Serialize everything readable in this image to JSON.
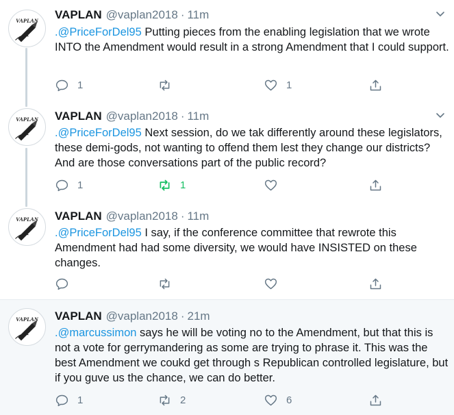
{
  "tweets": [
    {
      "name": "VAPLAN",
      "handle": "@vaplan2018",
      "sep": "·",
      "time": "11m",
      "mention": ".@PriceForDel95",
      "body": " Putting pieces from the enabling legislation that we wrote INTO the Amendment would result in a strong Amendment that I could support.",
      "reply_count": "1",
      "retweet_count": "",
      "like_count": "1",
      "retweeted": false
    },
    {
      "name": "VAPLAN",
      "handle": "@vaplan2018",
      "sep": "·",
      "time": "11m",
      "mention": ".@PriceForDel95",
      "body": " Next session, do we tak differently around these legislators, these demi-gods, not wanting to offend them lest they change our districts? And are those conversations part of the public record?",
      "reply_count": "1",
      "retweet_count": "1",
      "like_count": "",
      "retweeted": true
    },
    {
      "name": "VAPLAN",
      "handle": "@vaplan2018",
      "sep": "·",
      "time": "11m",
      "mention": ".@PriceForDel95",
      "body": " I say, if the conference committee that rewrote this Amendment had had some diversity, we would have INSISTED on these changes.",
      "reply_count": "",
      "retweet_count": "",
      "like_count": "",
      "retweeted": false
    },
    {
      "name": "VAPLAN",
      "handle": "@vaplan2018",
      "sep": "·",
      "time": "21m",
      "mention": ".@marcussimon",
      "body": " says he will be voting no to the Amendment, but that this is not a vote for gerrymandering as some are trying to phrase it. This was the best Amendment we coukd get through s Republican controlled legislature, but if you guve us the chance, we can do better.",
      "reply_count": "1",
      "retweet_count": "2",
      "like_count": "6",
      "retweeted": false
    }
  ],
  "avatar_text": "VAPLAN",
  "colors": {
    "mention": "#1b95e0",
    "retweet_active": "#17bf63",
    "icon": "#657786",
    "thread_line": "#ccd6dd",
    "highlight_bg": "#f5f8fa"
  }
}
